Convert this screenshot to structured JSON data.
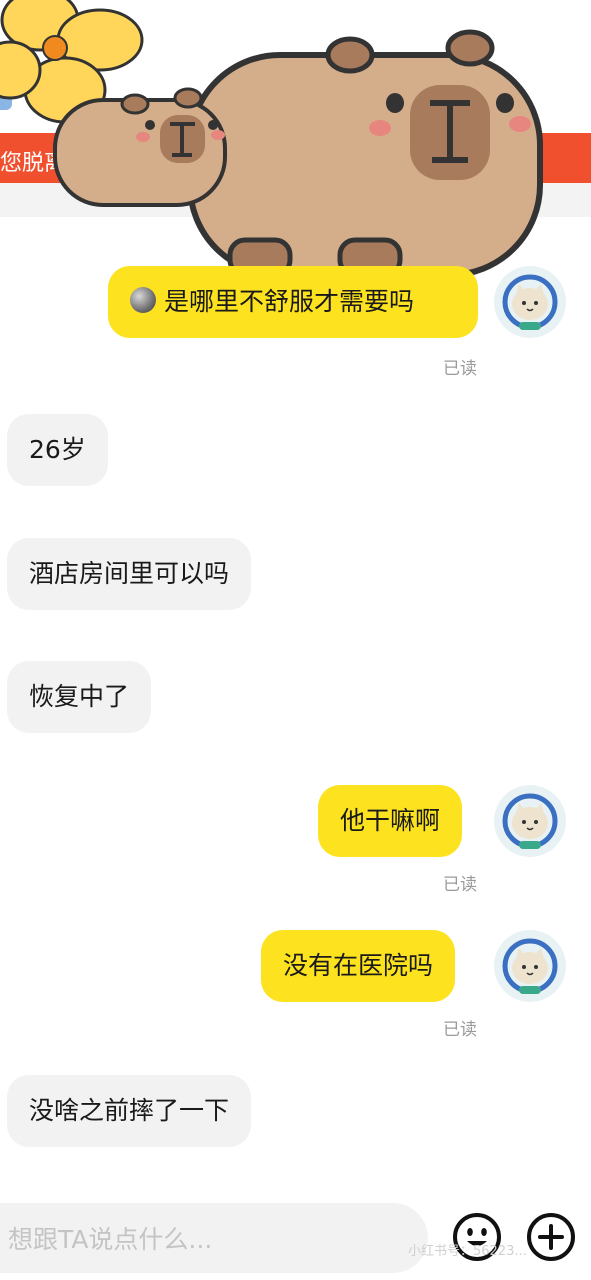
{
  "banner": {
    "text": "您脱离"
  },
  "messages": [
    {
      "side": "out",
      "text": "是哪里不舒服才需要吗",
      "read": "已读",
      "emoji": "moon-icon"
    },
    {
      "side": "in",
      "text": "26岁"
    },
    {
      "side": "in",
      "text": "酒店房间里可以吗"
    },
    {
      "side": "in",
      "text": "恢复中了"
    },
    {
      "side": "out",
      "text": "他干嘛啊",
      "read": "已读"
    },
    {
      "side": "out",
      "text": "没有在医院吗",
      "read": "已读"
    },
    {
      "side": "in",
      "text": "没啥之前摔了一下"
    }
  ],
  "input": {
    "placeholder": "想跟TA说点什么..."
  },
  "watermark": "小红书号：56223...",
  "colors": {
    "outgoing_bubble": "#fde31f",
    "incoming_bubble": "#f2f2f2",
    "banner": "#f1502f"
  }
}
